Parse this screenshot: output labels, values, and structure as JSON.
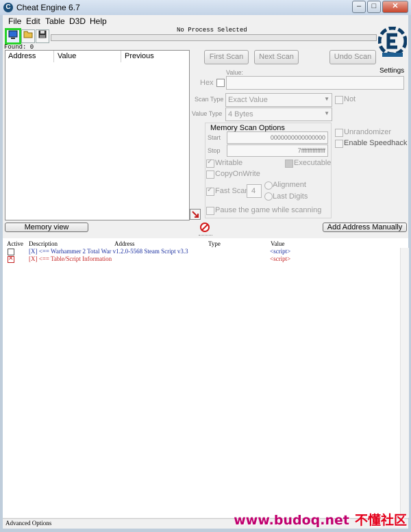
{
  "window": {
    "title": "Cheat Engine 6.7",
    "minimize": "–",
    "maximize": "□",
    "close": "✕"
  },
  "menu": [
    "File",
    "Edit",
    "Table",
    "D3D",
    "Help"
  ],
  "toolbar": {
    "open_process_icon": "computer-icon",
    "open_file_icon": "folder-icon",
    "save_icon": "floppy-icon"
  },
  "process_label": "No Process Selected",
  "found_label": "Found: 0",
  "settings_label": "Settings",
  "logo": {
    "brand_color": "#0d3c66",
    "accent_color": "#1f5f92"
  },
  "results": {
    "columns": [
      "Address",
      "Value",
      "Previous"
    ]
  },
  "scan": {
    "first_scan": "First Scan",
    "next_scan": "Next Scan",
    "undo_scan": "Undo Scan",
    "value_label": "Value:",
    "hex_label": "Hex",
    "scan_type_label": "Scan Type",
    "scan_type_value": "Exact Value",
    "not_label": "Not",
    "value_type_label": "Value Type",
    "value_type_value": "4 Bytes"
  },
  "memory_options": {
    "title": "Memory Scan Options",
    "start_label": "Start",
    "start_value": "0000000000000000",
    "stop_label": "Stop",
    "stop_value": "7fffffffffffffff",
    "writable": "Writable",
    "executable": "Executable",
    "copy_on_write": "CopyOnWrite",
    "fast_scan": "Fast Scan",
    "fast_scan_value": "4",
    "alignment": "Alignment",
    "last_digits": "Last Digits"
  },
  "side_options": {
    "unrandomizer": "Unrandomizer",
    "speedhack": "Enable Speedhack"
  },
  "pause_label": "Pause the game while scanning",
  "memory_view_button": "Memory view",
  "add_address_button": "Add Address Manually",
  "address_list": {
    "columns": [
      "Active",
      "Description",
      "Address",
      "Type",
      "Value"
    ],
    "rows": [
      {
        "description": "[X] <== Warhammer 2 Total War v1.2.0-5568 Steam Script v3.3",
        "value": "<script>",
        "color": "#1a2fa0"
      },
      {
        "description": "[X] <== Table/Script Information",
        "value": "<script>",
        "color": "#c42222"
      }
    ]
  },
  "status": {
    "advanced_options": "Advanced Options"
  },
  "watermark": {
    "url": "www.budoq.net",
    "text": "不懂社区"
  }
}
